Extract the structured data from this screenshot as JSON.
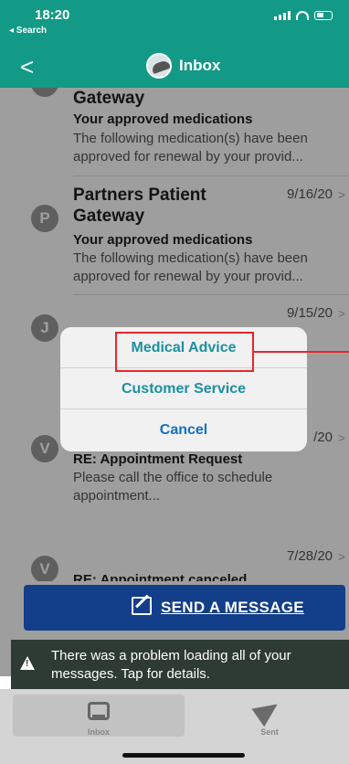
{
  "status_bar": {
    "time": "18:20",
    "back_label": "◂ Search"
  },
  "nav": {
    "back_glyph": "<",
    "title": "Inbox"
  },
  "messages": [
    {
      "initial": "P",
      "sender": "Gateway",
      "date": "",
      "subject": "Your approved medications",
      "preview": "The following medication(s) have been approved for renewal by your provid..."
    },
    {
      "initial": "P",
      "sender": "Partners Patient Gateway",
      "date": "9/16/20",
      "subject": "Your approved medications",
      "preview": "The following medication(s) have been approved for renewal by your provid..."
    },
    {
      "initial": "J",
      "sender": "",
      "date": "9/15/20",
      "subject": "",
      "preview": ""
    },
    {
      "initial": "V",
      "sender": "",
      "date": "/20",
      "subject": "RE: Appointment Request",
      "preview": "Please call the office to schedule appointment..."
    },
    {
      "initial": "V",
      "sender": "",
      "date": "7/28/20",
      "subject": "RE: Appointment canceled",
      "preview": ""
    }
  ],
  "action_sheet": {
    "options": [
      "Medical Advice",
      "Customer Service",
      "Cancel"
    ]
  },
  "send_button": {
    "label": "SEND A MESSAGE"
  },
  "banner": {
    "text": "There was a problem loading all of your messages. Tap for details."
  },
  "tabs": [
    {
      "label": "Inbox"
    },
    {
      "label": "Sent"
    }
  ],
  "colors": {
    "header": "#139a86",
    "send_button": "#123e8a",
    "highlight": "#e8262a"
  }
}
